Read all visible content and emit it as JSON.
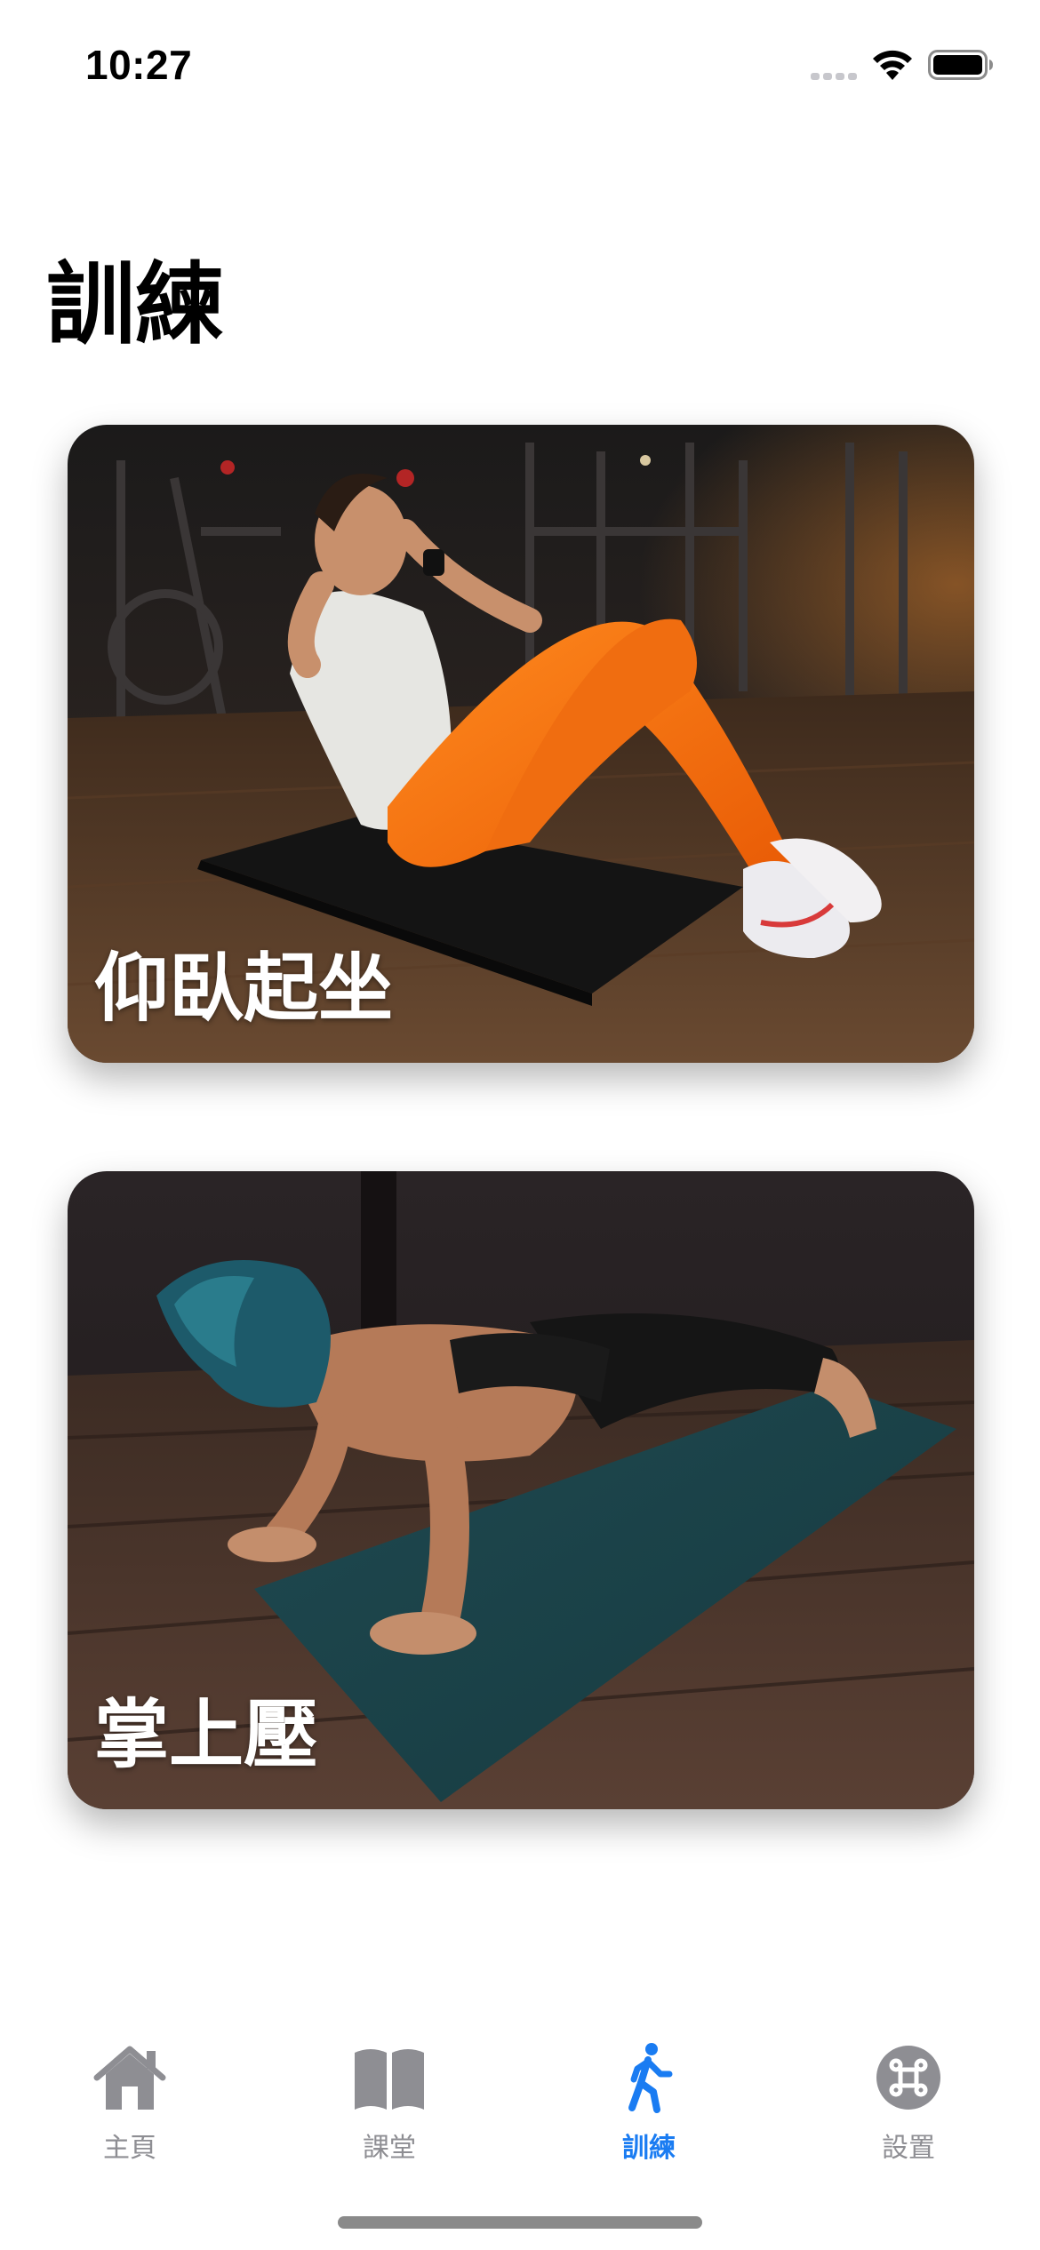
{
  "status_bar": {
    "time": "10:27"
  },
  "page": {
    "title": "訓練"
  },
  "cards": [
    {
      "title": "仰臥起坐",
      "image": "woman-doing-sit-ups-photo"
    },
    {
      "title": "掌上壓",
      "image": "woman-doing-push-ups-photo"
    }
  ],
  "tab_bar": {
    "items": [
      {
        "label": "主頁",
        "icon": "house-icon",
        "selected": false
      },
      {
        "label": "課堂",
        "icon": "book-icon",
        "selected": false
      },
      {
        "label": "訓練",
        "icon": "figure-walk-icon",
        "selected": true
      },
      {
        "label": "設置",
        "icon": "command-icon",
        "selected": false
      }
    ]
  },
  "colors": {
    "accent": "#1a7cf2",
    "inactive_tab": "#8e8e93",
    "background": "#ffffff"
  }
}
